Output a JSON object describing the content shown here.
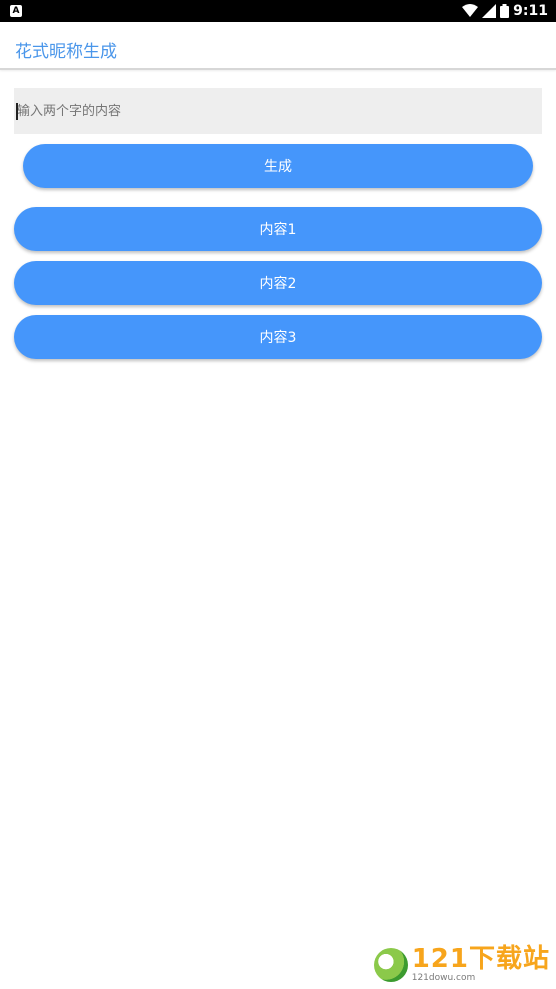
{
  "status_bar": {
    "notification_icon": "A",
    "time": "9:11",
    "icons": [
      "wifi-icon",
      "signal-icon",
      "battery-icon"
    ]
  },
  "app_bar": {
    "title": "花式昵称生成"
  },
  "input": {
    "placeholder": "输入两个字的内容",
    "value": ""
  },
  "buttons": {
    "generate": "生成",
    "content1": "内容1",
    "content2": "内容2",
    "content3": "内容3"
  },
  "colors": {
    "accent": "#4596fb",
    "title": "#4a96ea",
    "input_bg": "#eeeeee"
  },
  "watermark": {
    "main": "121下载站",
    "sub": "121dowu.com"
  }
}
